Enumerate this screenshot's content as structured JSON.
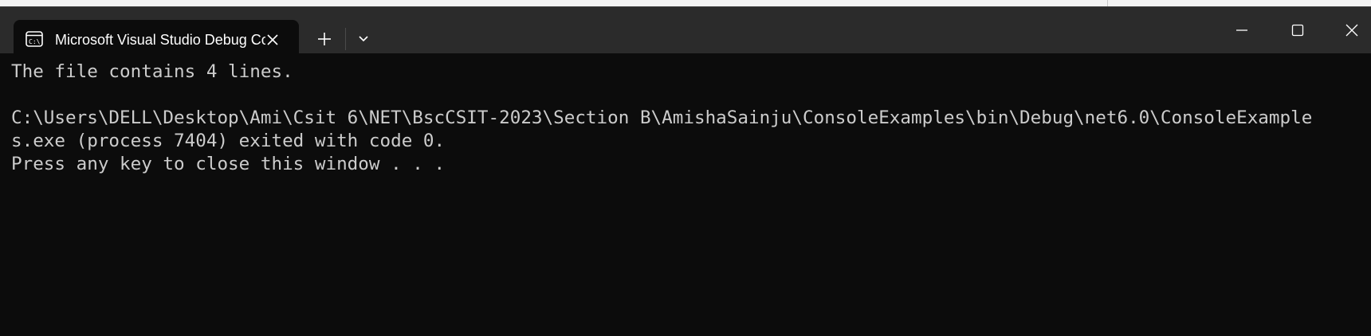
{
  "window": {
    "tab_title": "Microsoft Visual Studio Debug Console",
    "tab_icon": "console-icon",
    "new_tab_icon": "plus-icon",
    "dropdown_icon": "chevron-down-icon",
    "controls": {
      "minimize_icon": "minimize-icon",
      "maximize_icon": "maximize-icon",
      "close_icon": "close-icon"
    },
    "colors": {
      "titlebar": "#2b2b2b",
      "terminal_bg": "#0c0c0c",
      "terminal_text": "#cccccc"
    }
  },
  "terminal": {
    "lines": [
      "The file contains 4 lines.",
      "",
      "C:\\Users\\DELL\\Desktop\\Ami\\Csit 6\\NET\\BscCSIT-2023\\Section B\\AmishaSainju\\ConsoleExamples\\bin\\Debug\\net6.0\\ConsoleExample",
      "s.exe (process 7404) exited with code 0.",
      "Press any key to close this window . . ."
    ]
  }
}
